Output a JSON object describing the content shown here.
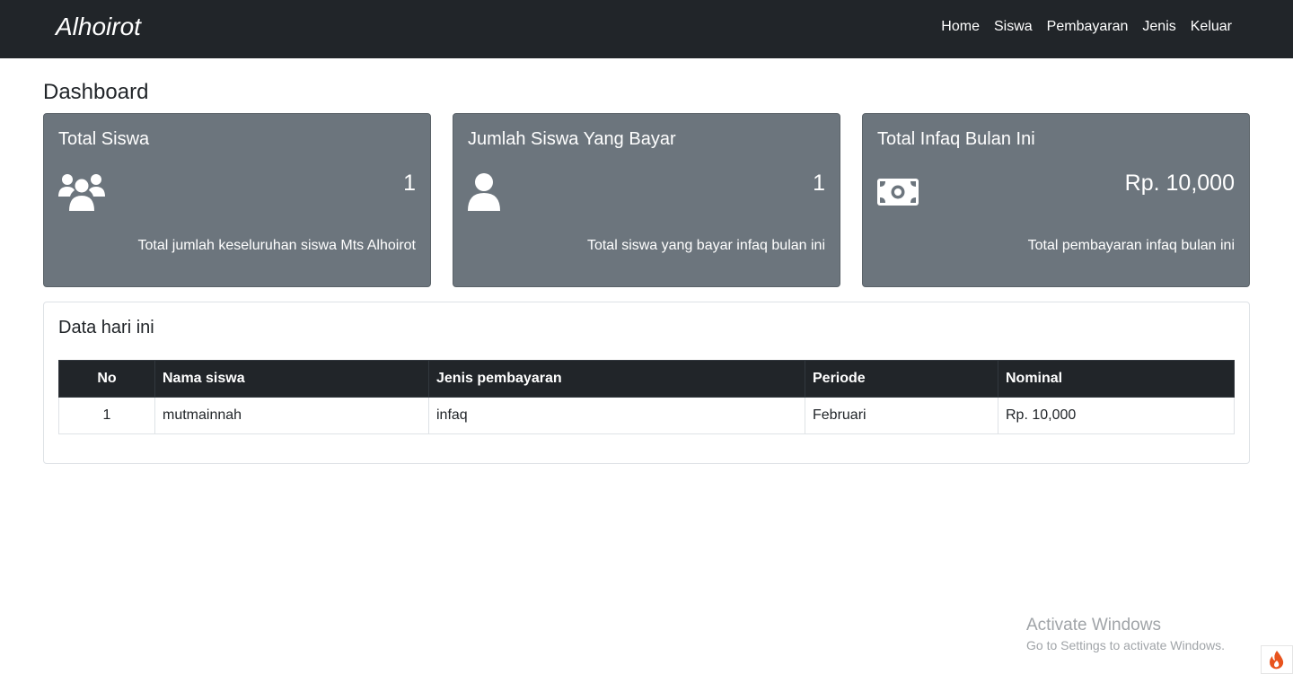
{
  "navbar": {
    "brand": "Alhoirot",
    "links": [
      "Home",
      "Siswa",
      "Pembayaran",
      "Jenis",
      "Keluar"
    ]
  },
  "page_title": "Dashboard",
  "cards": [
    {
      "title": "Total Siswa",
      "icon": "users-icon",
      "value": "1",
      "footer": "Total jumlah keseluruhan siswa Mts Alhoirot"
    },
    {
      "title": "Jumlah Siswa Yang Bayar",
      "icon": "user-icon",
      "value": "1",
      "footer": "Total siswa yang bayar infaq bulan ini"
    },
    {
      "title": "Total Infaq Bulan Ini",
      "icon": "money-bill-icon",
      "value": "Rp. 10,000",
      "footer": "Total pembayaran infaq bulan ini"
    }
  ],
  "today": {
    "title": "Data hari ini",
    "columns": [
      "No",
      "Nama siswa",
      "Jenis pembayaran",
      "Periode",
      "Nominal"
    ],
    "rows": [
      [
        "1",
        "mutmainnah",
        "infaq",
        "Februari",
        "Rp. 10,000"
      ]
    ]
  },
  "watermark": {
    "line1": "Activate Windows",
    "line2": "Go to Settings to activate Windows."
  },
  "colors": {
    "navbar": "#212529",
    "card": "#6c757d",
    "table_header": "#212529",
    "flame": "#e8531d"
  }
}
